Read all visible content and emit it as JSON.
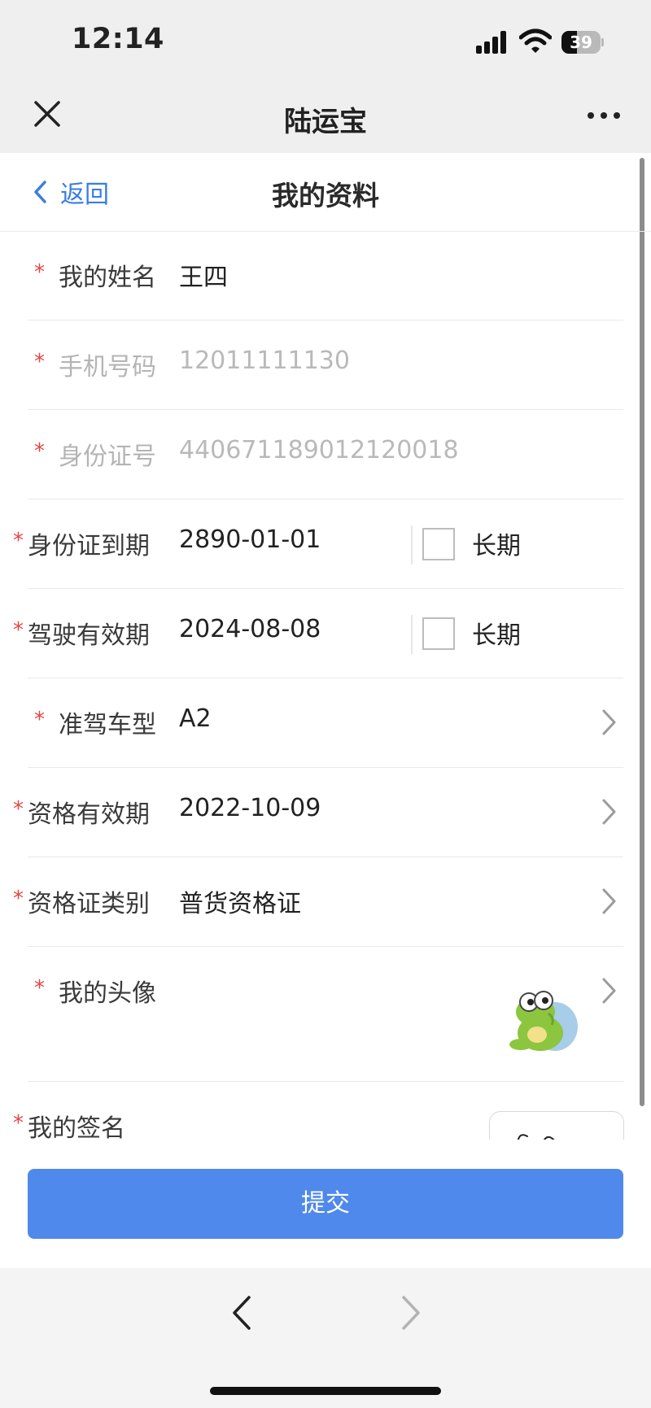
{
  "status_bar": {
    "time": "12:14",
    "battery_level": "39",
    "battery_fraction": 0.39
  },
  "app_bar": {
    "title": "陆运宝",
    "close_icon": "close-icon",
    "more_icon": "more-icon"
  },
  "nav": {
    "back_label": "返回",
    "title": "我的资料"
  },
  "form": {
    "required_mark": "*",
    "name": {
      "label": "我的姓名",
      "value": "王四"
    },
    "phone": {
      "label": "手机号码",
      "value": "12011111130"
    },
    "id_number": {
      "label": "身份证号",
      "value": "440671189012120018"
    },
    "id_expiry": {
      "label": "身份证到期",
      "value": "2890-01-01",
      "long_term_label": "长期",
      "long_term_checked": false
    },
    "license_expiry": {
      "label": "驾驶有效期",
      "value": "2024-08-08",
      "long_term_label": "长期",
      "long_term_checked": false
    },
    "vehicle_class": {
      "label": "准驾车型",
      "value": "A2"
    },
    "qualification_expiry": {
      "label": "资格有效期",
      "value": "2022-10-09"
    },
    "qualification_type": {
      "label": "资格证类别",
      "value": "普货资格证"
    },
    "avatar": {
      "label": "我的头像"
    },
    "signature": {
      "label": "我的签名"
    }
  },
  "submit": {
    "label": "提交"
  },
  "colors": {
    "accent": "#5089ec",
    "link": "#3a7de0",
    "required": "#e54545"
  }
}
